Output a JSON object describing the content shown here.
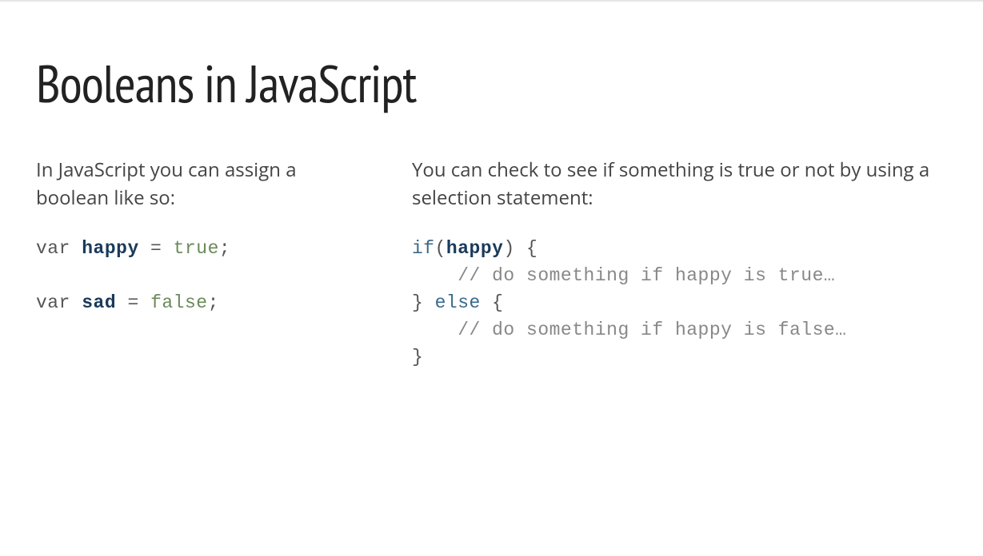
{
  "title": "Booleans in JavaScript",
  "left": {
    "intro": "In JavaScript you can assign a boolean like so:",
    "code1": {
      "kw": "var",
      "name": "happy",
      "eq": " = ",
      "val": "true",
      "semi": ";"
    },
    "code2": {
      "kw": "var",
      "name": "sad",
      "eq": " = ",
      "val": "false",
      "semi": ";"
    }
  },
  "right": {
    "intro": "You can check to see if something is true or not by using a selection statement:",
    "code": {
      "ifkw": "if",
      "lparen": "(",
      "cond": "happy",
      "rparen": ")",
      "lbrace": " {",
      "comment1": "    // do something if happy is true…",
      "rbrace1": "}",
      "elsekw": " else ",
      "lbrace2": "{",
      "comment2": "    // do something if happy is false…",
      "rbrace2": "}"
    }
  }
}
